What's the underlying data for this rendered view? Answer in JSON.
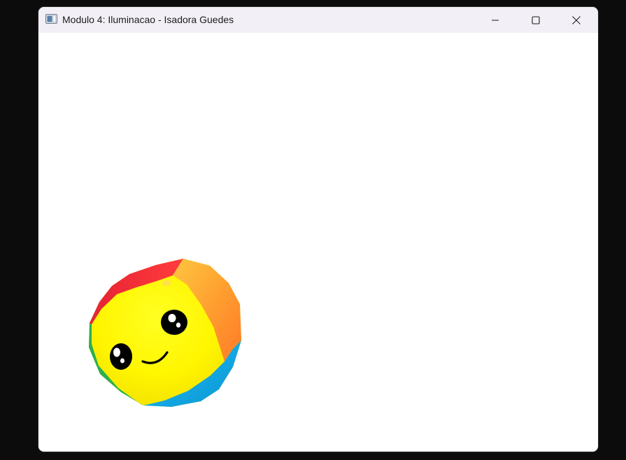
{
  "window": {
    "title": "Modulo 4: Iluminacao - Isadora Guedes",
    "app_icon": "window-app-icon",
    "controls": {
      "minimize_icon": "minimize-icon",
      "maximize_icon": "maximize-icon",
      "close_icon": "close-icon"
    }
  },
  "viewport": {
    "background": "#ffffff",
    "object": {
      "name": "smiling-ball",
      "face_color": "#ffff00",
      "patch_colors": {
        "top": "#f5303a",
        "right": "#ffa020",
        "bottom": "#10a8e0",
        "left": "#22b04a"
      },
      "eye_color": "#000000",
      "mouth_color": "#000000"
    }
  }
}
